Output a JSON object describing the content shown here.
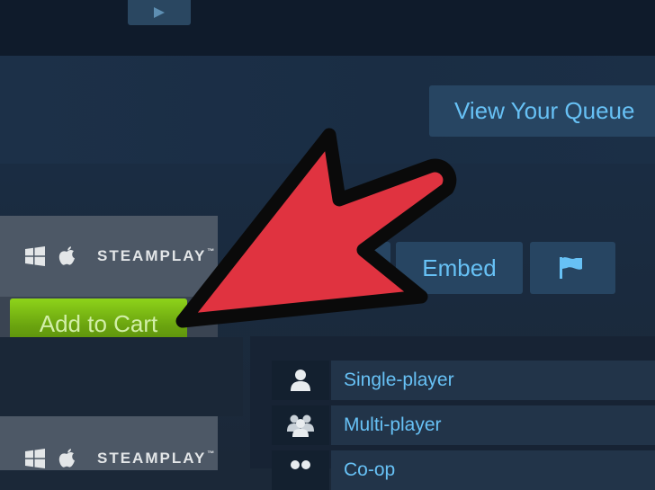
{
  "header": {
    "queue_button_label": "View Your Queue"
  },
  "purchase": {
    "platform_logo_text": "STEAMPLAY",
    "platform_logo_tm": "™",
    "platform_icons": [
      "windows-icon",
      "apple-icon"
    ],
    "add_to_cart_label": "Add to Cart"
  },
  "media_actions": {
    "embed_label": "Embed",
    "flag_icon": "flag-icon"
  },
  "features": [
    {
      "icon": "single-player-icon",
      "label": "Single-player"
    },
    {
      "icon": "multi-player-icon",
      "label": "Multi-player"
    },
    {
      "icon": "co-op-icon",
      "label": "Co-op"
    }
  ],
  "colors": {
    "background": "#1b2838",
    "link_blue": "#67c1f5",
    "button_blue": "#274562",
    "cart_green": "#6aa30f",
    "purchase_box": "#4d5866",
    "arrow_red": "#e03340"
  }
}
